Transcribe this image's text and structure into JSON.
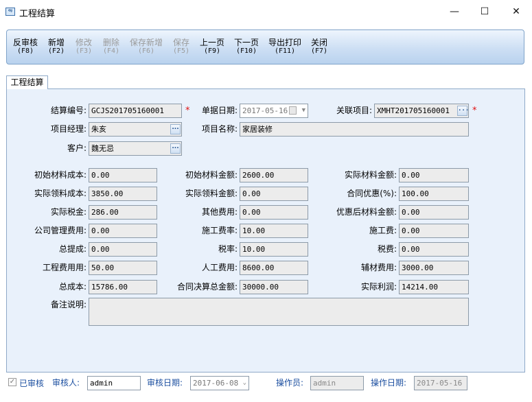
{
  "window": {
    "title": "工程结算",
    "icon_text": "ᴳᴶ"
  },
  "toolbar": {
    "buttons": [
      {
        "label": "反审核",
        "key": "(F8)",
        "enabled": true
      },
      {
        "label": "新增",
        "key": "(F2)",
        "enabled": true
      },
      {
        "label": "修改",
        "key": "(F3)",
        "enabled": false
      },
      {
        "label": "删除",
        "key": "(F4)",
        "enabled": false
      },
      {
        "label": "保存新增",
        "key": "(F6)",
        "enabled": false
      },
      {
        "label": "保存",
        "key": "(F5)",
        "enabled": false
      },
      {
        "label": "上一页",
        "key": "(F9)",
        "enabled": true
      },
      {
        "label": "下一页",
        "key": "(F10)",
        "enabled": true
      },
      {
        "label": "导出打印",
        "key": "(F11)",
        "enabled": true
      },
      {
        "label": "关闭",
        "key": "(F7)",
        "enabled": true
      }
    ]
  },
  "tab": {
    "label": "工程结算"
  },
  "header": {
    "settle_no": {
      "label": "结算编号:",
      "value": "GCJS201705160001"
    },
    "doc_date": {
      "label": "单据日期:",
      "value": "2017-05-16"
    },
    "related": {
      "label": "关联项目:",
      "value": "XMHT201705160001"
    },
    "manager": {
      "label": "项目经理:",
      "value": "朱亥"
    },
    "project_name": {
      "label": "项目名称:",
      "value": "家居装修"
    },
    "customer": {
      "label": "客户:",
      "value": "魏无忌"
    },
    "required_mark": "*",
    "lookup_btn": "..."
  },
  "amounts": {
    "col1": [
      {
        "label": "初始材料成本:",
        "value": "0.00"
      },
      {
        "label": "实际领料成本:",
        "value": "3850.00"
      },
      {
        "label": "实际税金:",
        "value": "286.00"
      },
      {
        "label": "公司管理费用:",
        "value": "0.00"
      },
      {
        "label": "总提成:",
        "value": "0.00"
      },
      {
        "label": "工程费用用:",
        "value": "50.00"
      },
      {
        "label": "总成本:",
        "value": "15786.00"
      }
    ],
    "col2": [
      {
        "label": "初始材料金额:",
        "value": "2600.00"
      },
      {
        "label": "实际领料金额:",
        "value": "0.00"
      },
      {
        "label": "其他费用:",
        "value": "0.00"
      },
      {
        "label": "施工费率:",
        "value": "10.00"
      },
      {
        "label": "税率:",
        "value": "10.00"
      },
      {
        "label": "人工费用:",
        "value": "8600.00"
      },
      {
        "label": "合同决算总金额:",
        "value": "30000.00"
      }
    ],
    "col3": [
      {
        "label": "实际材料金额:",
        "value": "0.00"
      },
      {
        "label": "合同优惠(%):",
        "value": "100.00"
      },
      {
        "label": "优惠后材料金额:",
        "value": "0.00"
      },
      {
        "label": "施工费:",
        "value": "0.00"
      },
      {
        "label": "税费:",
        "value": "0.00"
      },
      {
        "label": "辅材费用:",
        "value": "3000.00"
      },
      {
        "label": "实际利润:",
        "value": "14214.00"
      }
    ]
  },
  "remark": {
    "label": "备注说明:",
    "value": ""
  },
  "footer": {
    "audited_label": "已审核",
    "audited_checked": true,
    "auditor": {
      "label": "审核人:",
      "value": "admin"
    },
    "audit_date": {
      "label": "审核日期:",
      "value": "2017-06-08"
    },
    "operator": {
      "label": "操作员:",
      "value": "admin"
    },
    "op_date": {
      "label": "操作日期:",
      "value": "2017-05-16"
    }
  }
}
